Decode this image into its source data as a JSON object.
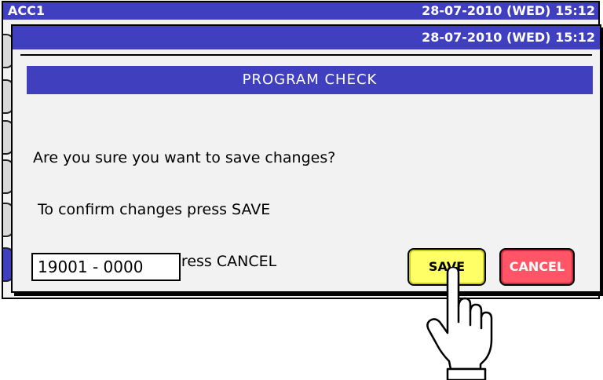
{
  "background_window": {
    "title": "ACC1",
    "datetime": "28-07-2010 (WED)  15:12"
  },
  "dialog": {
    "datetime": "28-07-2010 (WED)  15:12",
    "header": "PROGRAM CHECK",
    "message_lines": [
      "Are you sure you want to save changes?",
      " To confirm changes press SAVE",
      "  to undo changes press CANCEL"
    ],
    "code_value": "19001 - 0000",
    "save_label": "SAVE",
    "cancel_label": "CANCEL"
  },
  "colors": {
    "titlebar": "#3f3fbf",
    "save": "#ffff66",
    "cancel": "#ff5566"
  },
  "icons": {
    "pointer": "pointing-hand-icon"
  }
}
